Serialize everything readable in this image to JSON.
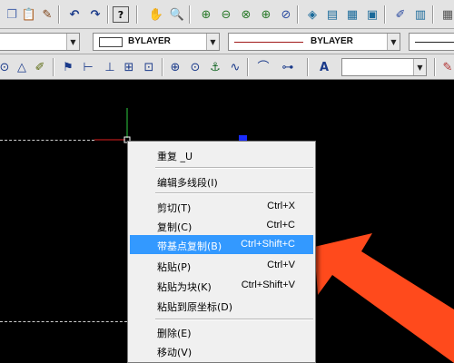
{
  "toolbar_top": {
    "icons": [
      "copy-icon",
      "paste-icon",
      "match-properties-icon",
      "undo-icon",
      "redo-icon",
      "help-icon",
      "pan-icon",
      "zoom-realtime-icon",
      "zoom-in-icon",
      "zoom-out-icon",
      "zoom-window-icon",
      "zoom-extents-icon",
      "zoom-previous-icon",
      "properties-icon",
      "design-center-icon",
      "tool-palettes-icon",
      "sheet-set-icon",
      "markup-icon",
      "calculator-icon",
      "layer-manager-icon",
      "layer-states-icon"
    ]
  },
  "toolbar_properties": {
    "color_value": "BYLAYER",
    "linetype_value": "BYLAYER"
  },
  "toolbar_dimension": {
    "icons": [
      "dim-continue-icon",
      "dim-ordinate-icon",
      "dim-angular-icon",
      "quick-dim-icon",
      "dim-linear-icon",
      "dim-aligned-icon",
      "dim-baseline-icon",
      "dim-tolerance-icon",
      "dim-center-mark-icon",
      "dim-inspect-icon",
      "dim-jogged-icon",
      "dim-edit-icon",
      "dim-text-edit-icon",
      "dim-update-icon",
      "dim-style-icon"
    ]
  },
  "context_menu": {
    "items": [
      {
        "label": "重复 _U",
        "shortcut": ""
      },
      {
        "label": "编辑多线段(I)",
        "shortcut": ""
      },
      {
        "label": "剪切(T)",
        "shortcut": "Ctrl+X"
      },
      {
        "label": "复制(C)",
        "shortcut": "Ctrl+C"
      },
      {
        "label": "带基点复制(B)",
        "shortcut": "Ctrl+Shift+C"
      },
      {
        "label": "粘贴(P)",
        "shortcut": "Ctrl+V"
      },
      {
        "label": "粘贴为块(K)",
        "shortcut": "Ctrl+Shift+V"
      },
      {
        "label": "粘贴到原坐标(D)",
        "shortcut": ""
      },
      {
        "label": "删除(E)",
        "shortcut": ""
      },
      {
        "label": "移动(V)",
        "shortcut": ""
      }
    ],
    "highlighted_index": 4
  },
  "colors": {
    "highlight": "#3399ff",
    "arrow": "#ff4a1c",
    "canvas": "#000000",
    "crosshair_y": "#2ecc40",
    "crosshair_x": "#e02020",
    "grip": "#1a2cff"
  }
}
